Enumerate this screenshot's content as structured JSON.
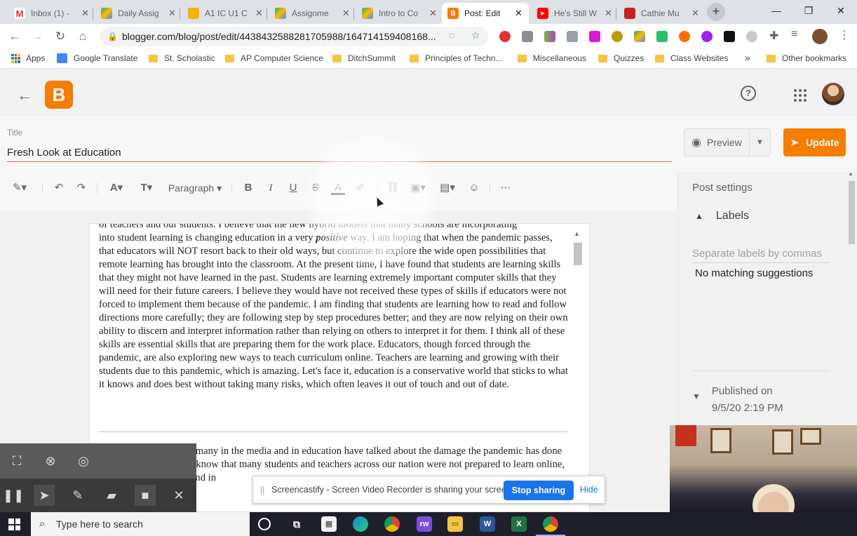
{
  "browser": {
    "tabs": [
      {
        "label": "Inbox (1) - ",
        "icon": "gmail-icon",
        "color": "#d93025"
      },
      {
        "label": "Daily Assig",
        "icon": "drive-icon",
        "color": "#34a853"
      },
      {
        "label": "A1 IC U1 C",
        "icon": "slides-icon",
        "color": "#f4b400"
      },
      {
        "label": "Assignme",
        "icon": "drive-icon",
        "color": "#34a853"
      },
      {
        "label": "Intro to Co",
        "icon": "drive-icon",
        "color": "#34a853"
      },
      {
        "label": "Post: Edit",
        "icon": "blogger-icon",
        "color": "#f57d00"
      },
      {
        "label": "He's Still W",
        "icon": "youtube-icon",
        "color": "#ff0000"
      },
      {
        "label": "Cathie Mu",
        "icon": "classroom-icon",
        "color": "#c5221f"
      }
    ],
    "url": "blogger.com/blog/post/edit/4438432588281705988/164714159408168...",
    "bookmarks": [
      "Apps",
      "Google Translate",
      "St. Scholastic",
      "AP Computer Science",
      "DitchSummit",
      "Principles of Techn...",
      "Miscellaneous",
      "Quizzes",
      "Class Websites",
      "»",
      "Other bookmarks"
    ]
  },
  "blogger": {
    "title_label": "Title",
    "title_value": "Fresh Look at Education",
    "preview_label": "Preview",
    "update_label": "Update",
    "toolbar": {
      "paragraph_label": "Paragraph",
      "bold": "B",
      "italic": "I",
      "underline": "U"
    },
    "body": {
      "line0": "of teachers and our students. I believe that the new hybrid models that many schools are incorporating",
      "p1_before": "into student learning is changing education in a very ",
      "p1_emph": "positive",
      "p1_after": " way. I am hoping that when the pandemic passes, that educators will NOT resort back to their old ways, but continue to explore the wide open possibilities that remote learning has brought into the classroom. At the present time, I have found that students are learning skills that they might not have learned in the past. Students are learning extremely important computer skills that they will need for their future careers. I believe they would have not received these types of skills if educators were not forced to implement them because of the pandemic. I am finding that students are learning how to read and follow directions more carefully; they are following step by step procedures better; and they are now relying on their own ability to discern and interpret information rather than relying on others to interpret it for them. I think all of these skills are essential skills that are preparing them for the work place. Educators, though forced through the pandemic, are also exploring new ways to teach curriculum online. Teachers are learning and growing with their students due to this pandemic, which is amazing. Let's face it, education is a conservative world that sticks to what it knows and does best without taking many risks, which often leaves it out of touch and out of date.",
      "p2": "Despite current events, many in the media and in education have talked about the damage the pandemic has done to student learning. We know that many students and teachers across our nation were not prepared to learn online, ...tools not being ...behind in"
    },
    "sidebar": {
      "title": "Post settings",
      "labels": "Labels",
      "labels_placeholder": "Separate labels by commas",
      "no_suggestions": "No matching suggestions",
      "published_line1": "Published on",
      "published_line2": "9/5/20 2:19 PM"
    }
  },
  "screencastify": {
    "message": "Screencastify - Screen Video Recorder is sharing your screen.",
    "stop_label": "Stop sharing",
    "hide_label": "Hide"
  },
  "taskbar": {
    "search_placeholder": "Type here to search"
  },
  "colors": {
    "accent": "#f57d00",
    "link": "#1a73e8"
  }
}
